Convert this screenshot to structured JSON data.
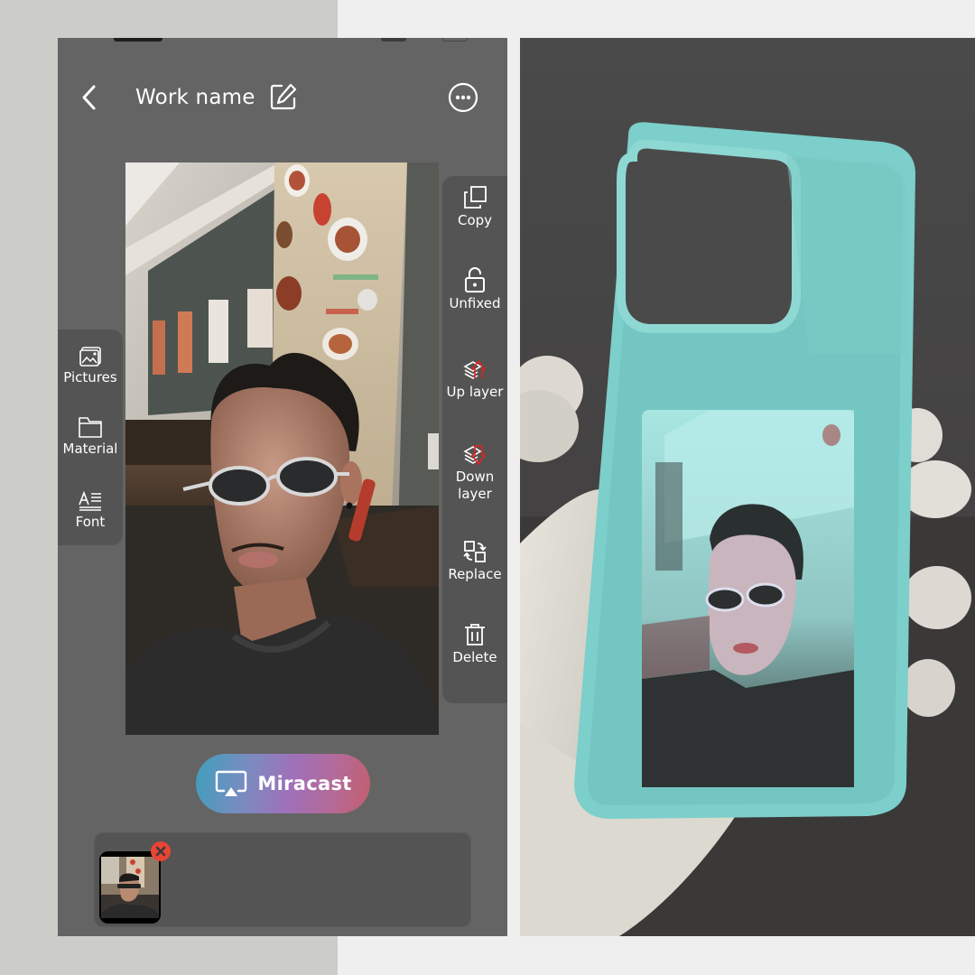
{
  "header": {
    "title": "Work name",
    "back_icon": "chevron-left-icon",
    "edit_icon": "edit-pencil-icon",
    "more_icon": "more-horizontal-circle-icon"
  },
  "left_tools": [
    {
      "label": "Pictures",
      "icon": "image-icon"
    },
    {
      "label": "Material",
      "icon": "folder-icon"
    },
    {
      "label": "Font",
      "icon": "font-text-icon"
    }
  ],
  "right_tools": [
    {
      "label": "Copy",
      "icon": "copy-icon"
    },
    {
      "label": "Unfixed",
      "icon": "unlock-icon"
    },
    {
      "label": "Up layer",
      "icon": "layer-up-icon"
    },
    {
      "label": "Down layer",
      "icon": "layer-down-icon"
    },
    {
      "label": "Replace",
      "icon": "replace-icon"
    },
    {
      "label": "Delete",
      "icon": "trash-icon"
    }
  ],
  "canvas": {
    "image": "selfie-photo",
    "description": "Selfie of man with sunglasses in restaurant"
  },
  "miracast": {
    "label": "Miracast",
    "icon": "screen-cast-icon",
    "gradient_colors": [
      "#3f9fbd",
      "#a070b8",
      "#c45e6c"
    ]
  },
  "tray": {
    "thumbnails": [
      {
        "name": "selfie-thumbnail",
        "remove_icon": "close-x-icon"
      }
    ]
  },
  "result_photo": {
    "description": "Hand holding teal phone case with e-ink display showing the selfie",
    "case_color": "#7ccfcb"
  },
  "colors": {
    "app_bg": "#646464",
    "panel_bg": "#545454",
    "accent_red": "#e94435",
    "page_bg_left": "#cccdc8",
    "page_bg_right": "#f0eff0"
  }
}
